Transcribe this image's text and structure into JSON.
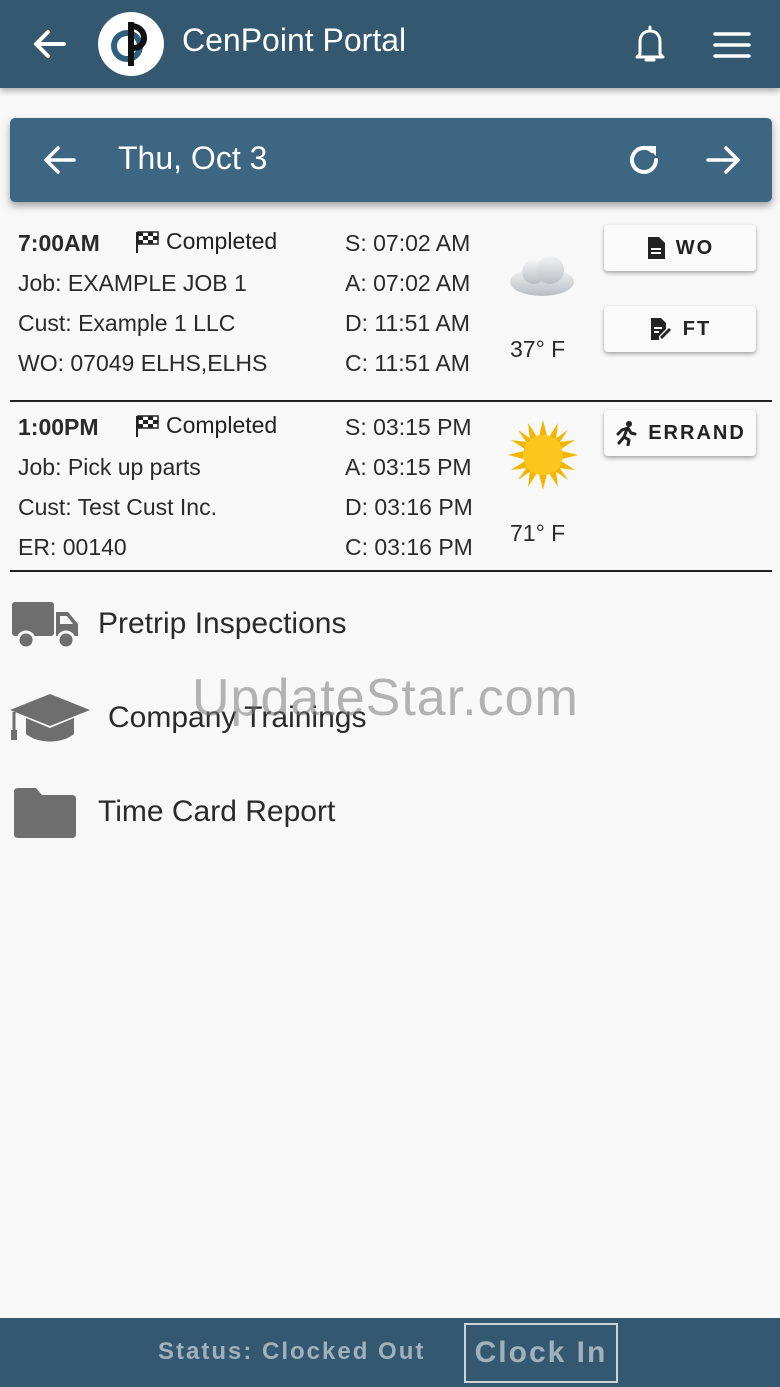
{
  "appbar": {
    "title": "CenPoint Portal",
    "color": "#34586f"
  },
  "datebar": {
    "date": "Thu, Oct 3",
    "color": "#3d6682"
  },
  "jobs": [
    {
      "time": "7:00AM",
      "status": "Completed",
      "job": "Job:  EXAMPLE JOB 1",
      "cust": "Cust: Example 1 LLC",
      "ref": "WO: 07049 ELHS,ELHS",
      "s": "S: 07:02 AM",
      "a": "A: 07:02 AM",
      "d": "D: 11:51 AM",
      "c": "C: 11:51 AM",
      "weather_icon": "cloud-icon",
      "temp": "37° F",
      "buttons": [
        {
          "label": "WO",
          "icon": "document-icon"
        },
        {
          "label": "FT",
          "icon": "edit-document-icon"
        }
      ]
    },
    {
      "time": "1:00PM",
      "status": "Completed",
      "job": "Job:  Pick up parts",
      "cust": "Cust: Test Cust Inc.",
      "ref": "ER: 00140",
      "s": "S: 03:15 PM",
      "a": "A: 03:15 PM",
      "d": "D: 03:16 PM",
      "c": "C: 03:16 PM",
      "weather_icon": "sun-icon",
      "temp": "71° F",
      "buttons": [
        {
          "label": "ERRAND",
          "icon": "running-person-icon"
        }
      ]
    }
  ],
  "links": [
    {
      "label": "Pretrip Inspections",
      "icon": "truck-icon"
    },
    {
      "label": "Company Trainings",
      "icon": "graduation-cap-icon"
    },
    {
      "label": "Time Card Report",
      "icon": "folder-icon"
    }
  ],
  "watermark": "UpdateStar.com",
  "bottombar": {
    "status": "Status: Clocked Out",
    "clock_in_label": "Clock In"
  }
}
